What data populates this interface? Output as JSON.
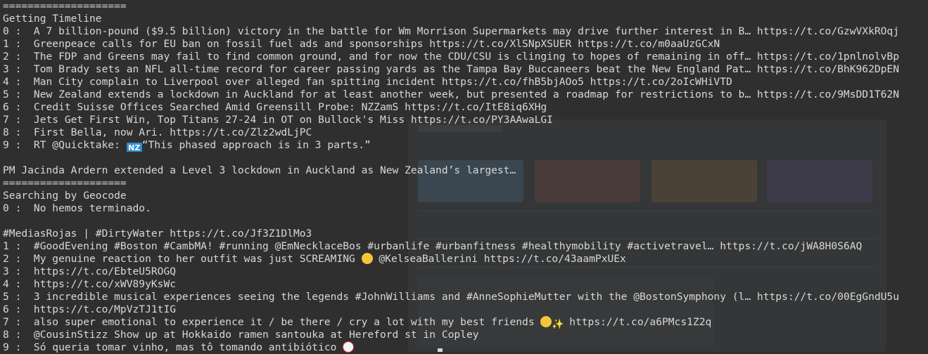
{
  "terminal": {
    "lines": [
      {
        "text": "===================="
      },
      {
        "text": "Getting Timeline"
      },
      {
        "text": "0 :  A 7 billion-pound ($9.5 billion) victory in the battle for Wm Morrison Supermarkets may drive further interest in B… https://t.co/GzwVXkROqj"
      },
      {
        "text": "1 :  Greenpeace calls for EU ban on fossil fuel ads and sponsorships https://t.co/XlSNpXSUER https://t.co/m0aaUzGCxN"
      },
      {
        "text": "2 :  The FDP and Greens may fail to find common ground, and for now the CDU/CSU is clinging to hopes of remaining in off… https://t.co/1pnlnolvBp"
      },
      {
        "text": "3 :  Tom Brady sets an NFL all-time record for career passing yards as the Tampa Bay Buccaneers beat the New England Pat… https://t.co/BhK962DpEN"
      },
      {
        "text": "4 :  Man City complain to Liverpool over alleged fan spitting incident https://t.co/fhB5bjAOo5 https://t.co/2oIcWHiVTD"
      },
      {
        "text": "5 :  New Zealand extends a lockdown in Auckland for at least another week, but presented a roadmap for restrictions to b… https://t.co/9MsDD1T62N"
      },
      {
        "text": "6 :  Credit Suisse Offices Searched Amid Greensill Probe: NZZamS https://t.co/ItE8iq6XHg"
      },
      {
        "text": "7 :  Jets Get First Win, Top Titans 27-24 in OT on Bullock's Miss https://t.co/PY3AAwaLGI"
      },
      {
        "text": "8 :  First Bella, now Ari. https://t.co/Zlz2wdLjPC"
      },
      {
        "text": "9 :  RT @Quicktake: ",
        "emoji": "flag-nz",
        "emoji_label": "NZ",
        "after": "“This phased approach is in 3 parts.”"
      },
      {
        "text": ""
      },
      {
        "text": "PM Jacinda Ardern extended a Level 3 lockdown in Auckland as New Zealand’s largest…"
      },
      {
        "text": "===================="
      },
      {
        "text": "Searching by Geocode"
      },
      {
        "text": "0 :  No hemos terminado."
      },
      {
        "text": ""
      },
      {
        "text": "#MediasRojas | #DirtyWater https://t.co/Jf3Z1DlMo3"
      },
      {
        "text": "1 :  #GoodEvening #Boston #CambMA! #running @EmNecklaceBos #urbanlife #urbanfitness #healthymobility #activetravel… https://t.co/jWA8H0S6AQ"
      },
      {
        "text": "2 :  My genuine reaction to her outfit was just SCREAMING ",
        "emoji": "laughing-emoji",
        "after": " @KelseaBallerini https://t.co/43aamPxUEx"
      },
      {
        "text": "3 :  https://t.co/EbteU5ROGQ"
      },
      {
        "text": "4 :  https://t.co/xWV89yKsWc"
      },
      {
        "text": "5 :  3 incredible musical experiences seeing the legends #JohnWilliams and #AnneSophieMutter with the @BostonSymphony (l… https://t.co/00EgGndU5u"
      },
      {
        "text": "6 :  https://t.co/MpVzTJ1tIG"
      },
      {
        "text": "7 :  also super emotional to experience it / be there / cry a lot with my best friends ",
        "emoji": "crying-emoji",
        "emoji2": "sparkles-emoji",
        "emoji2_label": "✨",
        "after": " https://t.co/a6PMcs1Z2q"
      },
      {
        "text": "8 :  @CousinStizz Show up at Hokkaido ramen santouka at Hereford st in Copley"
      },
      {
        "text": "9 :  Só queria tomar vinho, mas tô tomando antibiótico ",
        "emoji": "clown-emoji",
        "after": ""
      }
    ]
  }
}
